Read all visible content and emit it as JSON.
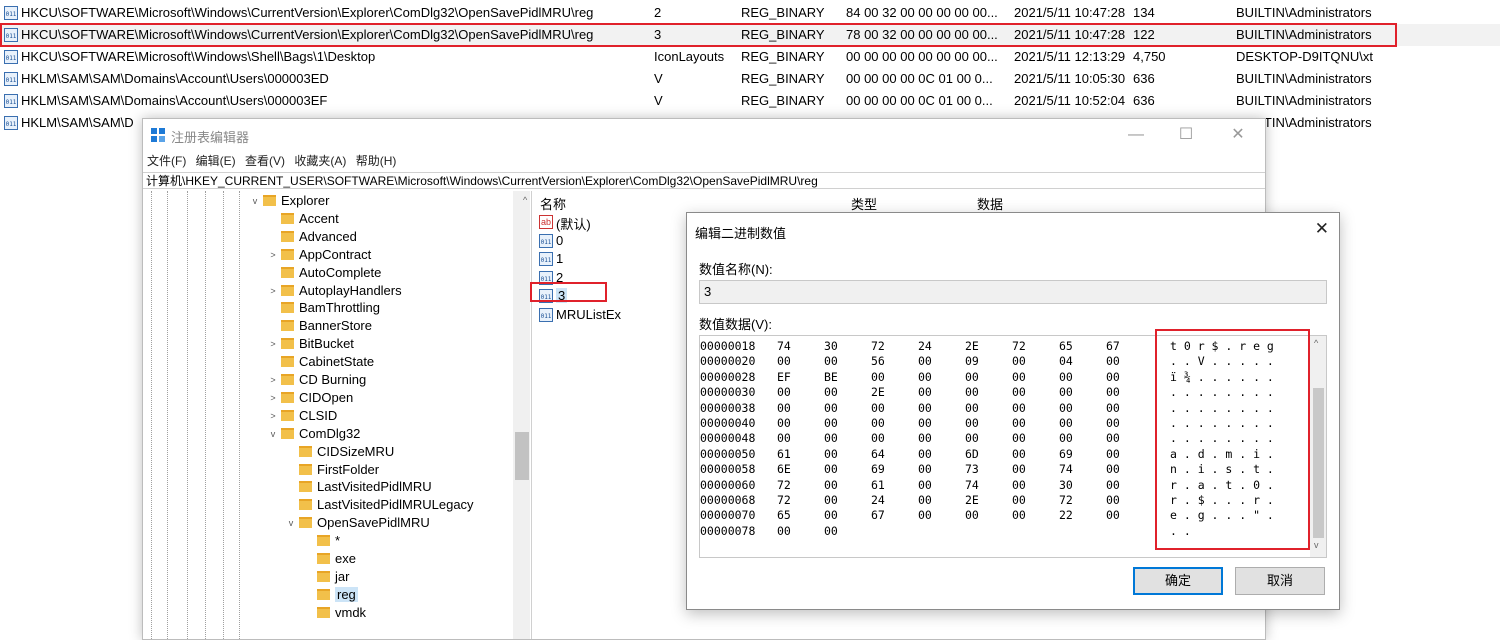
{
  "bg_rows": [
    {
      "path": "HKCU\\SOFTWARE\\Microsoft\\Windows\\CurrentVersion\\Explorer\\ComDlg32\\OpenSavePidlMRU\\reg",
      "name": "2",
      "type": "REG_BINARY",
      "data": "84 00 32 00 00 00 00 00...",
      "time": "2021/5/11 10:47:28",
      "size": "134",
      "owner": "BUILTIN\\Administrators"
    },
    {
      "path": "HKCU\\SOFTWARE\\Microsoft\\Windows\\CurrentVersion\\Explorer\\ComDlg32\\OpenSavePidlMRU\\reg",
      "name": "3",
      "type": "REG_BINARY",
      "data": "78 00 32 00 00 00 00 00...",
      "time": "2021/5/11 10:47:28",
      "size": "122",
      "owner": "BUILTIN\\Administrators"
    },
    {
      "path": "HKCU\\SOFTWARE\\Microsoft\\Windows\\Shell\\Bags\\1\\Desktop",
      "name": "IconLayouts",
      "type": "REG_BINARY",
      "data": "00 00 00 00 00 00 00 00...",
      "time": "2021/5/11 12:13:29",
      "size": "4,750",
      "owner": "DESKTOP-D9ITQNU\\xt"
    },
    {
      "path": "HKLM\\SAM\\SAM\\Domains\\Account\\Users\\000003ED",
      "name": "V",
      "type": "REG_BINARY",
      "data": "00 00 00 00 0C 01 00 0...",
      "time": "2021/5/11 10:05:30",
      "size": "636",
      "owner": "BUILTIN\\Administrators"
    },
    {
      "path": "HKLM\\SAM\\SAM\\Domains\\Account\\Users\\000003EF",
      "name": "V",
      "type": "REG_BINARY",
      "data": "00 00 00 00 0C 01 00 0...",
      "time": "2021/5/11 10:52:04",
      "size": "636",
      "owner": "BUILTIN\\Administrators"
    },
    {
      "path": "HKLM\\SAM\\SAM\\D",
      "name": "",
      "type": "",
      "data": "",
      "time": "",
      "size": "",
      "owner": "BUILTIN\\Administrators"
    }
  ],
  "regedit": {
    "title": "注册表编辑器",
    "menu": [
      "文件(F)",
      "编辑(E)",
      "查看(V)",
      "收藏夹(A)",
      "帮助(H)"
    ],
    "address": "计算机\\HKEY_CURRENT_USER\\SOFTWARE\\Microsoft\\Windows\\CurrentVersion\\Explorer\\ComDlg32\\OpenSavePidlMRU\\reg",
    "tree": [
      {
        "label": "Explorer",
        "exp": "v"
      },
      {
        "label": "Accent",
        "exp": ""
      },
      {
        "label": "Advanced",
        "exp": ""
      },
      {
        "label": "AppContract",
        "exp": ">"
      },
      {
        "label": "AutoComplete",
        "exp": ""
      },
      {
        "label": "AutoplayHandlers",
        "exp": ">"
      },
      {
        "label": "BamThrottling",
        "exp": ""
      },
      {
        "label": "BannerStore",
        "exp": ""
      },
      {
        "label": "BitBucket",
        "exp": ">"
      },
      {
        "label": "CabinetState",
        "exp": ""
      },
      {
        "label": "CD Burning",
        "exp": ">"
      },
      {
        "label": "CIDOpen",
        "exp": ">"
      },
      {
        "label": "CLSID",
        "exp": ">"
      },
      {
        "label": "ComDlg32",
        "exp": "v"
      },
      {
        "label": "CIDSizeMRU",
        "exp": ""
      },
      {
        "label": "FirstFolder",
        "exp": ""
      },
      {
        "label": "LastVisitedPidlMRU",
        "exp": ""
      },
      {
        "label": "LastVisitedPidlMRULegacy",
        "exp": ""
      },
      {
        "label": "OpenSavePidlMRU",
        "exp": "v"
      },
      {
        "label": "*",
        "exp": ""
      },
      {
        "label": "exe",
        "exp": ""
      },
      {
        "label": "jar",
        "exp": ""
      },
      {
        "label": "reg",
        "exp": ""
      },
      {
        "label": "vmdk",
        "exp": ""
      }
    ],
    "columns": {
      "name": "名称",
      "type": "类型",
      "data": "数据"
    },
    "values": [
      "(默认)",
      "0",
      "1",
      "2",
      "3",
      "MRUListEx"
    ]
  },
  "dialog": {
    "title": "编辑二进制数值",
    "name_label": "数值名称(N):",
    "name_value": "3",
    "data_label": "数值数据(V):",
    "ok": "确定",
    "cancel": "取消",
    "rows": [
      {
        "addr": "00000018",
        "bytes": [
          "74",
          "30",
          "72",
          "24",
          "2E",
          "72",
          "65",
          "67"
        ],
        "ascii": "t 0 r $ . r e g"
      },
      {
        "addr": "00000020",
        "bytes": [
          "00",
          "00",
          "56",
          "00",
          "09",
          "00",
          "04",
          "00"
        ],
        "ascii": ". . V . . . . ."
      },
      {
        "addr": "00000028",
        "bytes": [
          "EF",
          "BE",
          "00",
          "00",
          "00",
          "00",
          "00",
          "00"
        ],
        "ascii": "ï ¾ . . . . . ."
      },
      {
        "addr": "00000030",
        "bytes": [
          "00",
          "00",
          "2E",
          "00",
          "00",
          "00",
          "00",
          "00"
        ],
        "ascii": ". . . . . . . ."
      },
      {
        "addr": "00000038",
        "bytes": [
          "00",
          "00",
          "00",
          "00",
          "00",
          "00",
          "00",
          "00"
        ],
        "ascii": ". . . . . . . ."
      },
      {
        "addr": "00000040",
        "bytes": [
          "00",
          "00",
          "00",
          "00",
          "00",
          "00",
          "00",
          "00"
        ],
        "ascii": ". . . . . . . ."
      },
      {
        "addr": "00000048",
        "bytes": [
          "00",
          "00",
          "00",
          "00",
          "00",
          "00",
          "00",
          "00"
        ],
        "ascii": ". . . . . . . ."
      },
      {
        "addr": "00000050",
        "bytes": [
          "61",
          "00",
          "64",
          "00",
          "6D",
          "00",
          "69",
          "00"
        ],
        "ascii": "a . d . m . i ."
      },
      {
        "addr": "00000058",
        "bytes": [
          "6E",
          "00",
          "69",
          "00",
          "73",
          "00",
          "74",
          "00"
        ],
        "ascii": "n . i . s . t ."
      },
      {
        "addr": "00000060",
        "bytes": [
          "72",
          "00",
          "61",
          "00",
          "74",
          "00",
          "30",
          "00"
        ],
        "ascii": "r . a . t . 0 ."
      },
      {
        "addr": "00000068",
        "bytes": [
          "72",
          "00",
          "24",
          "00",
          "2E",
          "00",
          "72",
          "00"
        ],
        "ascii": "r . $ . . . r ."
      },
      {
        "addr": "00000070",
        "bytes": [
          "65",
          "00",
          "67",
          "00",
          "00",
          "00",
          "22",
          "00"
        ],
        "ascii": "e . g . . . \" ."
      },
      {
        "addr": "00000078",
        "bytes": [
          "00",
          "00"
        ],
        "ascii": ". ."
      }
    ]
  },
  "colors": {
    "highlight_red": "#e0212b",
    "folder": "#f2c04a",
    "selection": "#cce4f7",
    "accent": "#0078d7"
  }
}
